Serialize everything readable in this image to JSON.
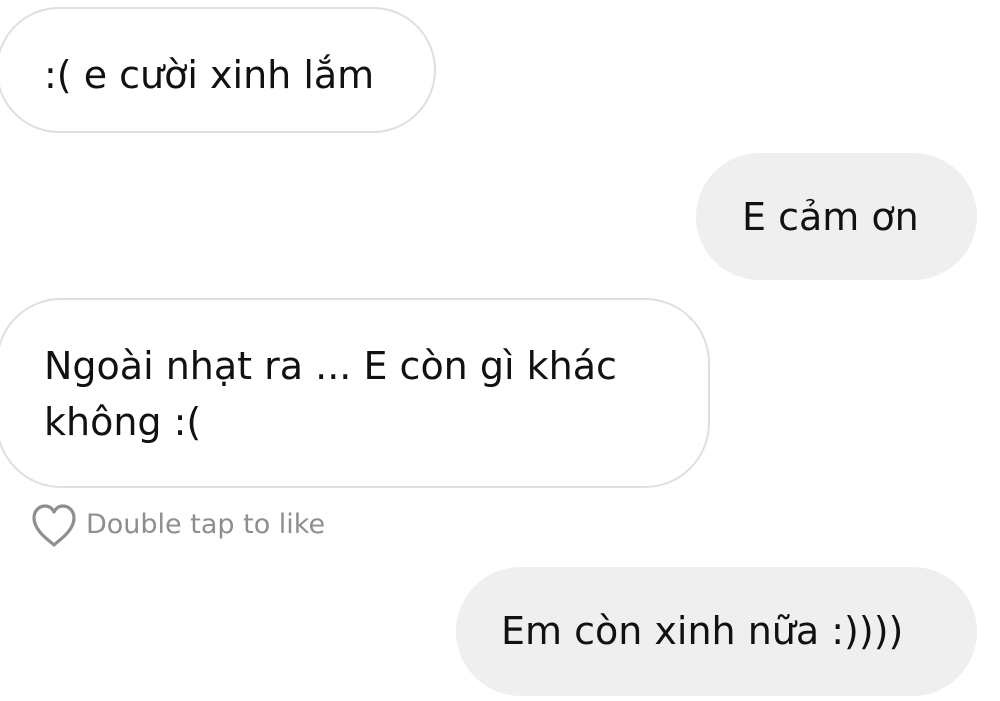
{
  "messages": [
    {
      "direction": "incoming",
      "text": ":( e cười xinh lắm"
    },
    {
      "direction": "outgoing",
      "text": "E cảm ơn"
    },
    {
      "direction": "incoming",
      "text": "Ngoài nhạt ra ... E còn gì khác\nkhông :("
    },
    {
      "direction": "outgoing",
      "text": "Em còn xinh nữa :))))"
    }
  ],
  "like_hint": {
    "icon": "heart-outline-icon",
    "label": "Double tap to like"
  },
  "colors": {
    "incoming_bubble_border": "#dfdfdf",
    "outgoing_bubble_bg": "#efefef",
    "hint_text": "#8e8e8e"
  }
}
